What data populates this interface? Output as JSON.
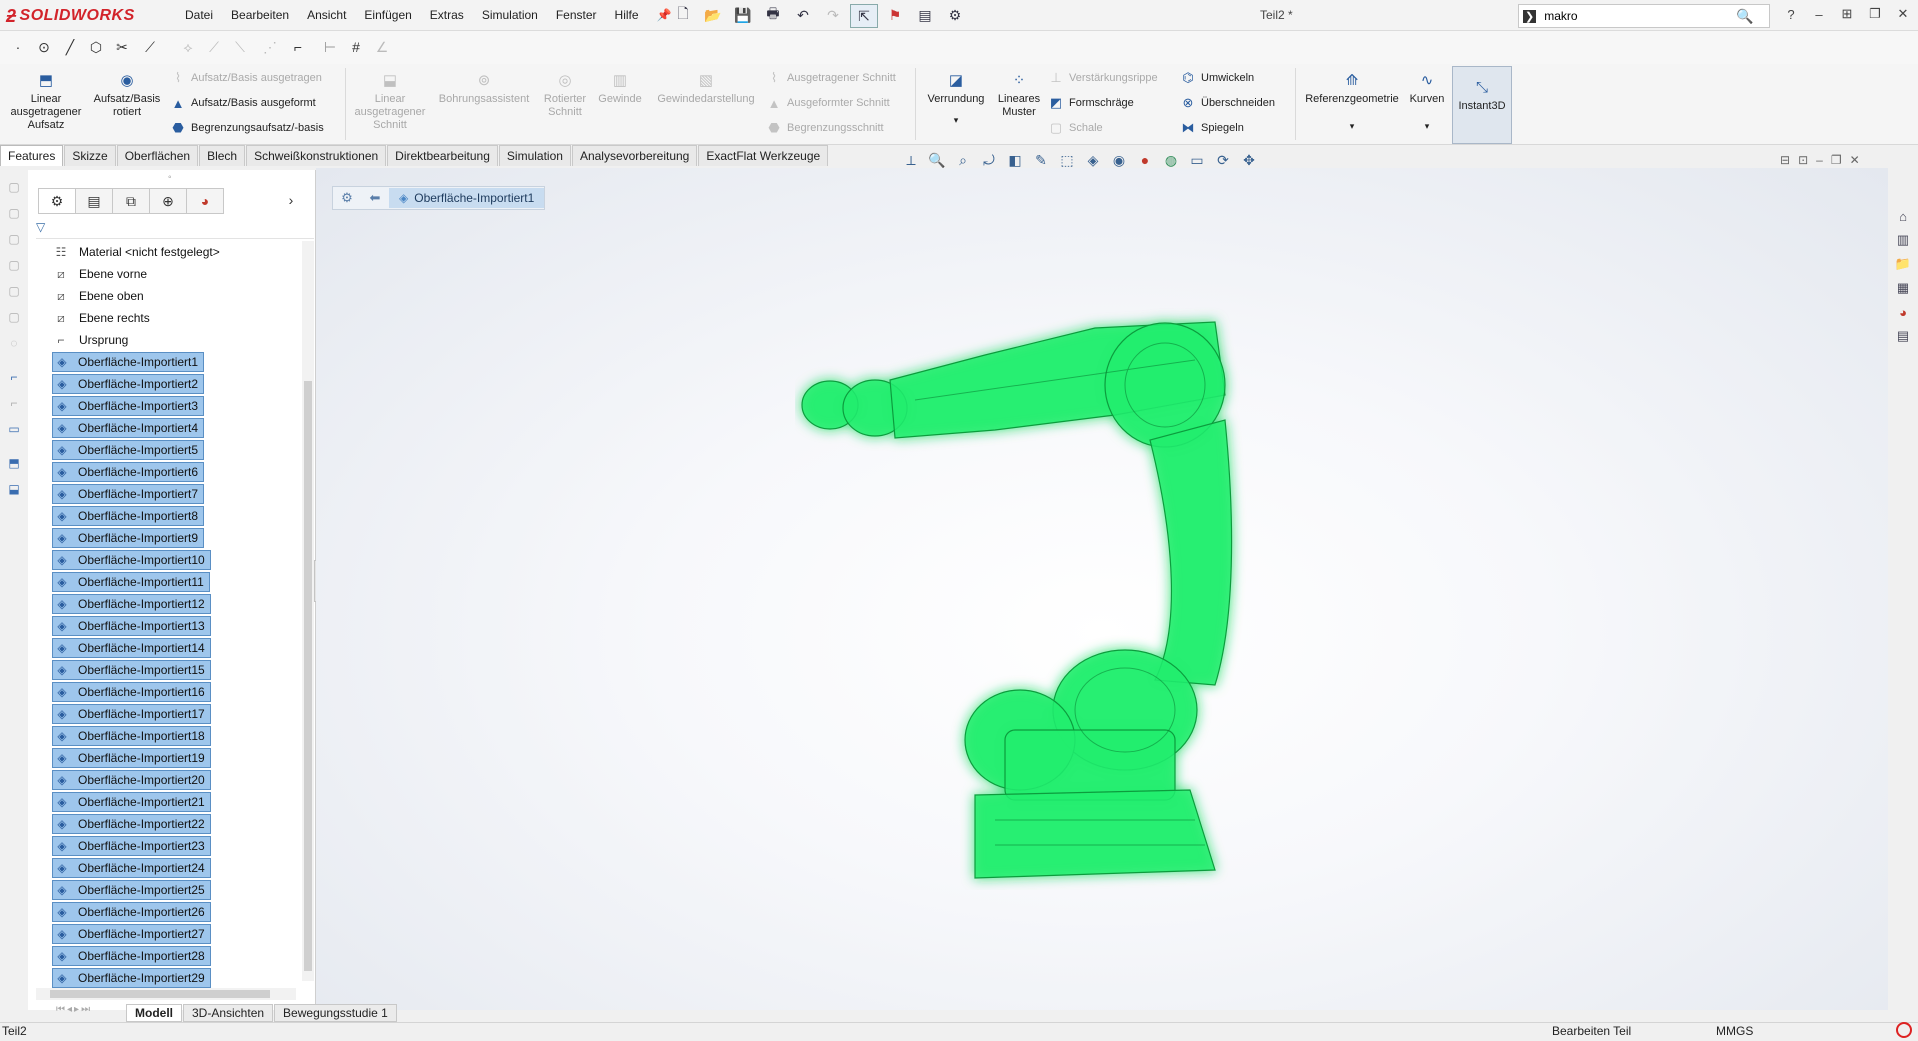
{
  "app": {
    "brand": "SOLIDWORKS",
    "document_title": "Teil2 *"
  },
  "menu": [
    "Datei",
    "Bearbeiten",
    "Ansicht",
    "Einfügen",
    "Extras",
    "Simulation",
    "Fenster",
    "Hilfe"
  ],
  "search": {
    "value": "makro"
  },
  "commands": {
    "extrude_boss": "Linear\nausgetragener\nAufsatz",
    "revolve_boss": "Aufsatz/Basis\nrotiert",
    "swept_boss": "Aufsatz/Basis ausgetragen",
    "lofted_boss": "Aufsatz/Basis ausgeformt",
    "boundary_boss": "Begrenzungsaufsatz/-basis",
    "extrude_cut": "Linear\nausgetragener\nSchnitt",
    "hole_wizard": "Bohrungsassistent",
    "revolve_cut": "Rotierter\nSchnitt",
    "thread": "Gewinde",
    "cosmetic_thread": "Gewindedarstellung",
    "swept_cut": "Ausgetragener Schnitt",
    "lofted_cut": "Ausgeformter Schnitt",
    "boundary_cut": "Begrenzungsschnitt",
    "fillet": "Verrundung",
    "linear_pattern": "Lineares\nMuster",
    "rib": "Verstärkungsrippe",
    "draft": "Formschräge",
    "shell": "Schale",
    "wrap": "Umwickeln",
    "intersect": "Überschneiden",
    "mirror": "Spiegeln",
    "ref_geometry": "Referenzgeometrie",
    "curves": "Kurven",
    "instant3d": "Instant3D"
  },
  "tabs": [
    "Features",
    "Skizze",
    "Oberflächen",
    "Blech",
    "Schweißkonstruktionen",
    "Direktbearbeitung",
    "Simulation",
    "Analysevorbereitung",
    "ExactFlat Werkzeuge"
  ],
  "tree": {
    "material": "Material <nicht festgelegt>",
    "planes": [
      "Ebene vorne",
      "Ebene oben",
      "Ebene rechts"
    ],
    "origin": "Ursprung",
    "surfaces": [
      "Oberfläche-Importiert1",
      "Oberfläche-Importiert2",
      "Oberfläche-Importiert3",
      "Oberfläche-Importiert4",
      "Oberfläche-Importiert5",
      "Oberfläche-Importiert6",
      "Oberfläche-Importiert7",
      "Oberfläche-Importiert8",
      "Oberfläche-Importiert9",
      "Oberfläche-Importiert10",
      "Oberfläche-Importiert11",
      "Oberfläche-Importiert12",
      "Oberfläche-Importiert13",
      "Oberfläche-Importiert14",
      "Oberfläche-Importiert15",
      "Oberfläche-Importiert16",
      "Oberfläche-Importiert17",
      "Oberfläche-Importiert18",
      "Oberfläche-Importiert19",
      "Oberfläche-Importiert20",
      "Oberfläche-Importiert21",
      "Oberfläche-Importiert22",
      "Oberfläche-Importiert23",
      "Oberfläche-Importiert24",
      "Oberfläche-Importiert25",
      "Oberfläche-Importiert26",
      "Oberfläche-Importiert27",
      "Oberfläche-Importiert28",
      "Oberfläche-Importiert29"
    ]
  },
  "breadcrumb": {
    "label": "Oberfläche-Importiert1"
  },
  "bottom_tabs": [
    "Modell",
    "3D-Ansichten",
    "Bewegungsstudie 1"
  ],
  "status": {
    "left": "Teil2",
    "mode": "Bearbeiten Teil",
    "units": "MMGS"
  },
  "colors": {
    "selection": "#9ec6ec",
    "model": "#1ef06a",
    "brand": "#d2232a"
  }
}
